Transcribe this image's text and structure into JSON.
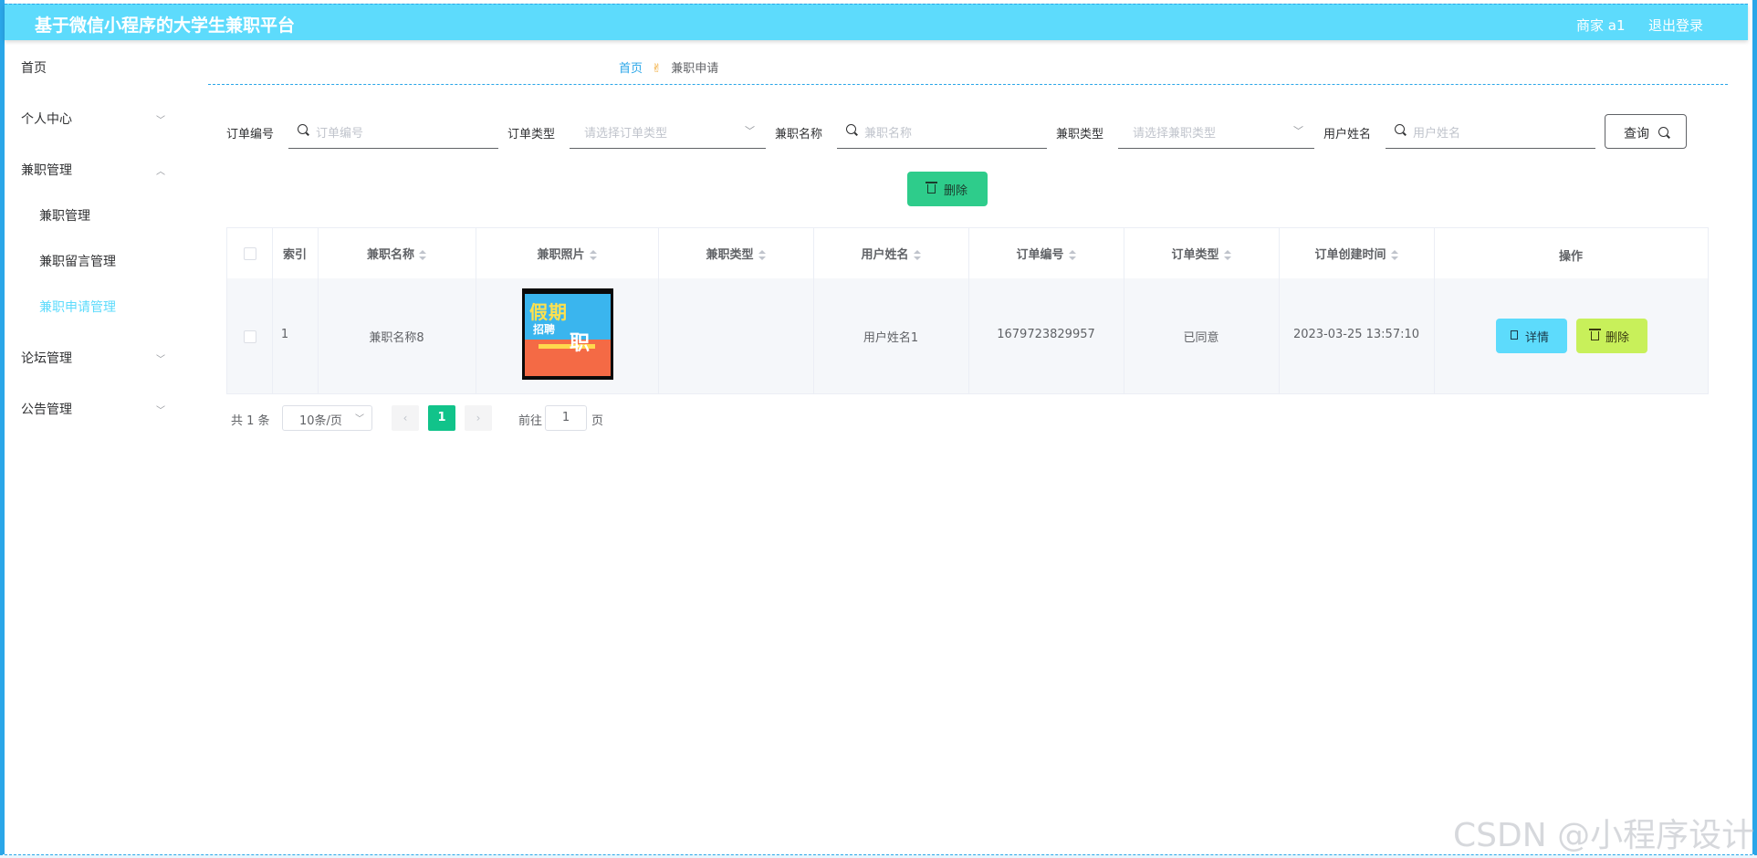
{
  "header": {
    "title": "基于微信小程序的大学生兼职平台",
    "user": "商家 a1",
    "logout": "退出登录"
  },
  "sidebar": {
    "items": [
      {
        "label": "首页"
      },
      {
        "label": "个人中心"
      },
      {
        "label": "兼职管理"
      },
      {
        "label": "兼职管理"
      },
      {
        "label": "兼职留言管理"
      },
      {
        "label": "兼职申请管理"
      },
      {
        "label": "论坛管理"
      },
      {
        "label": "公告管理"
      }
    ]
  },
  "breadcrumb": {
    "home": "首页",
    "current": "兼职申请"
  },
  "filters": {
    "order_no_label": "订单编号",
    "order_no_placeholder": "订单编号",
    "order_type_label": "订单类型",
    "order_type_placeholder": "请选择订单类型",
    "job_name_label": "兼职名称",
    "job_name_placeholder": "兼职名称",
    "job_type_label": "兼职类型",
    "job_type_placeholder": "请选择兼职类型",
    "user_name_label": "用户姓名",
    "user_name_placeholder": "用户姓名",
    "search_button": "查询"
  },
  "toolbar": {
    "delete_button": "删除"
  },
  "table": {
    "headers": [
      "索引",
      "兼职名称",
      "兼职照片",
      "兼职类型",
      "用户姓名",
      "订单编号",
      "订单类型",
      "订单创建时间",
      "操作"
    ],
    "rows": [
      {
        "index": "1",
        "job_name": "兼职名称8",
        "job_type": "",
        "user_name": "用户姓名1",
        "order_no": "1679723829957",
        "order_type": "已同意",
        "created_at": "2023-03-25 13:57:10",
        "detail_button": "详情",
        "delete_button": "删除"
      }
    ],
    "poster_text": {
      "line1": "假期",
      "line2": "招聘",
      "line3": "职"
    }
  },
  "pagination": {
    "total": "共 1 条",
    "page_size": "10条/页",
    "current_page": "1",
    "goto_prefix": "前往",
    "goto_value": "1",
    "goto_suffix": "页"
  },
  "watermark": "CSDN @小程序设计"
}
